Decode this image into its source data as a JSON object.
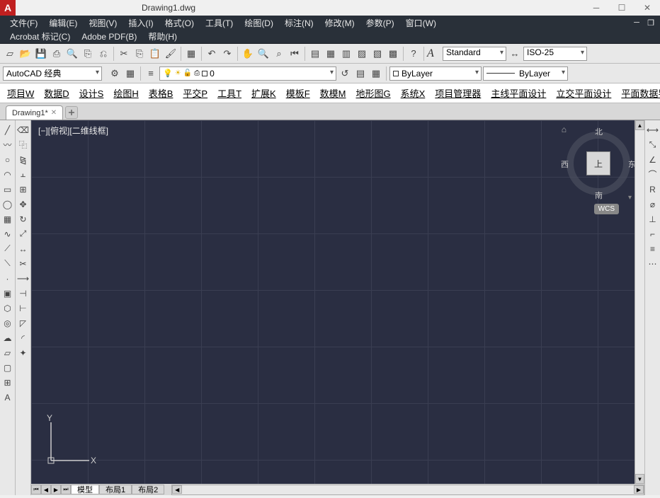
{
  "title": "Drawing1.dwg",
  "menu1": {
    "file": "文件(F)",
    "edit": "编辑(E)",
    "view": "视图(V)",
    "insert": "插入(I)",
    "format": "格式(O)",
    "tools": "工具(T)",
    "draw": "绘图(D)",
    "dim": "标注(N)",
    "modify": "修改(M)",
    "param": "参数(P)",
    "window": "窗口(W)"
  },
  "menu2": {
    "acrobat": "Acrobat 标记(C)",
    "adobe": "Adobe PDF(B)",
    "help": "帮助(H)"
  },
  "workspace": "AutoCAD 经典",
  "layerDropdown": {
    "name": "0"
  },
  "styles": {
    "text": "Standard",
    "dim": "ISO-25"
  },
  "colorControl": "ByLayer",
  "linetype": "ByLayer",
  "customTabs": {
    "project": "项目W",
    "data": "数据D",
    "design": "设计S",
    "draw": "绘图H",
    "table": "表格B",
    "plane": "平交P",
    "tools": "工具T",
    "ext": "扩展K",
    "template": "模板F",
    "nummodel": "数模M",
    "terrain": "地形图G",
    "system": "系统X",
    "projmgr": "项目管理器",
    "mainline": "主线平面设计",
    "inter": "立交平面设计",
    "dataio": "平面数据导入/导出"
  },
  "tabs": {
    "drawing1": "Drawing1*"
  },
  "viewport": {
    "label": "[−][俯视][二维线框]",
    "y": "Y",
    "x": "X"
  },
  "viewcube": {
    "top": "上",
    "north": "北",
    "south": "南",
    "east": "东",
    "west": "西"
  },
  "wcs": "WCS",
  "layoutTabs": {
    "model": "模型",
    "layout1": "布局1",
    "layout2": "布局2"
  }
}
